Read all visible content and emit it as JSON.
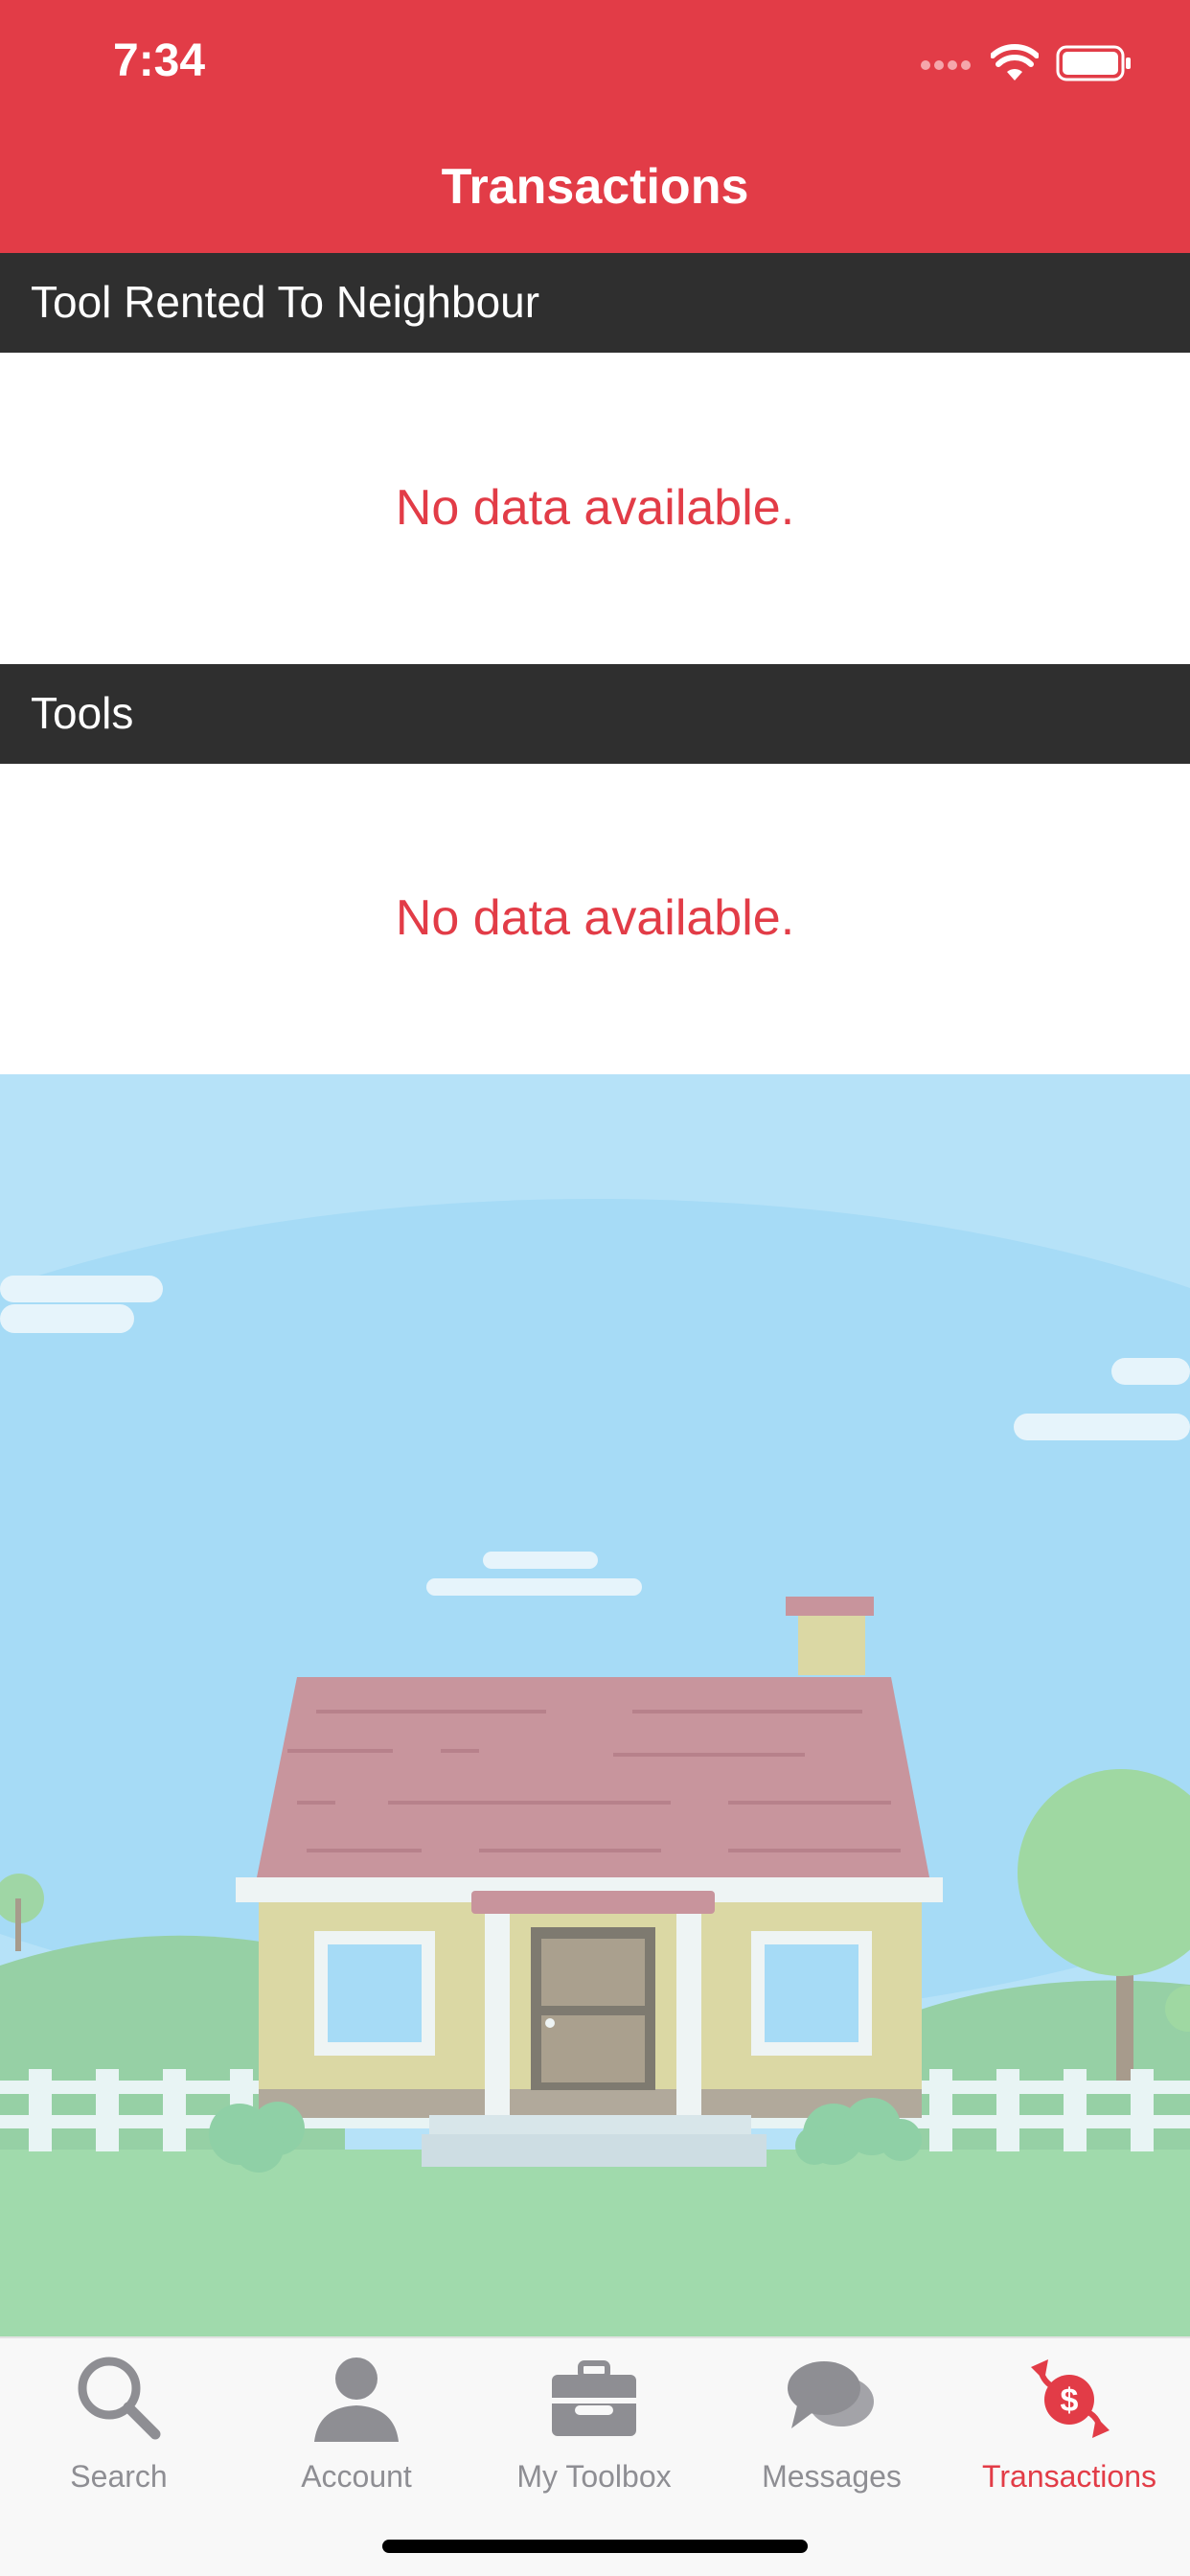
{
  "status_bar": {
    "time": "7:34"
  },
  "header": {
    "title": "Transactions"
  },
  "sections": [
    {
      "title": "Tool Rented To Neighbour",
      "empty_message": "No data available."
    },
    {
      "title": "Tools",
      "empty_message": "No data available."
    }
  ],
  "tabbar": {
    "tabs": [
      {
        "label": "Search",
        "icon": "search-icon"
      },
      {
        "label": "Account",
        "icon": "person-icon"
      },
      {
        "label": "My Toolbox",
        "icon": "toolbox-icon"
      },
      {
        "label": "Messages",
        "icon": "chat-bubbles-icon"
      },
      {
        "label": "Transactions",
        "icon": "dollar-exchange-icon",
        "active": true
      }
    ]
  },
  "colors": {
    "accent": "#e23c47",
    "section_header": "#2f2f2f",
    "tab_inactive": "#8e8e93"
  }
}
